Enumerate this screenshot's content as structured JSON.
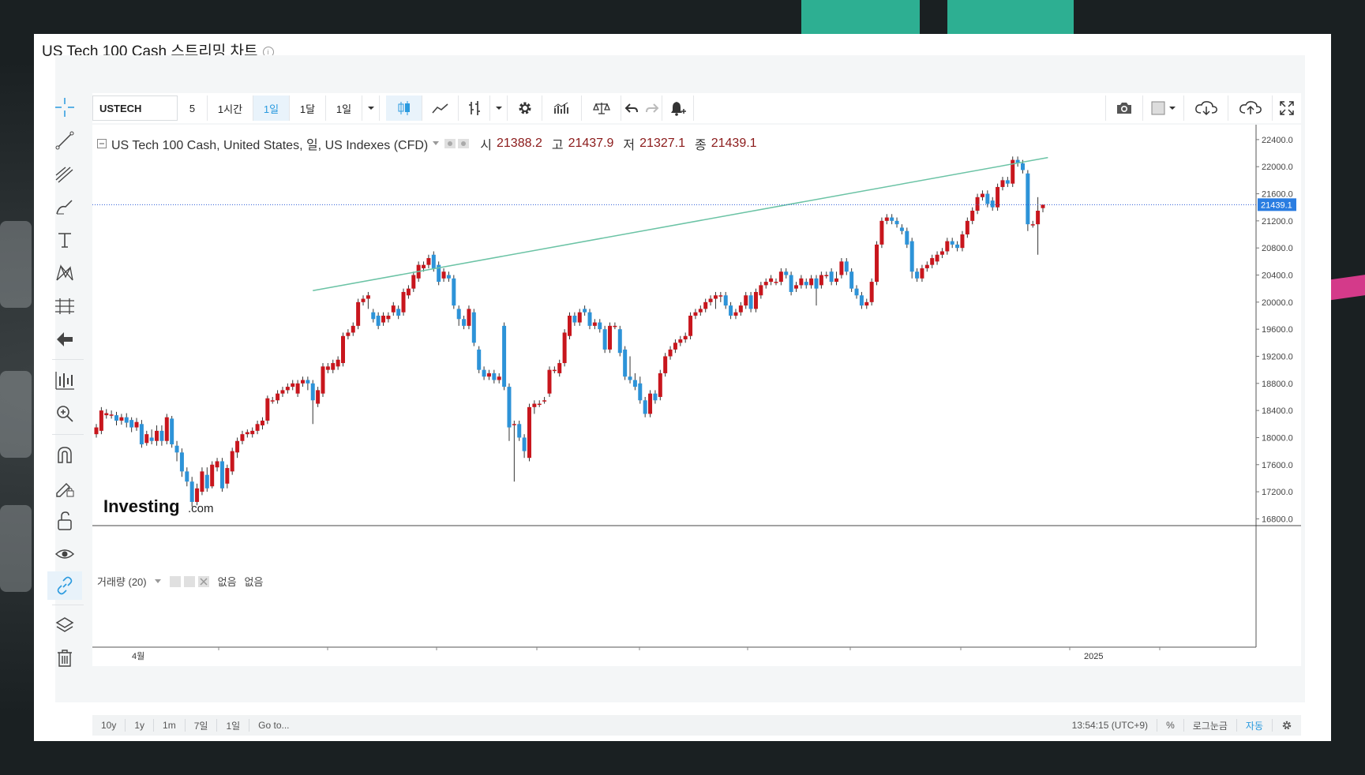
{
  "chart_title": "US Tech 100 Cash 스트리밍 차트",
  "toolbar": {
    "symbol": "USTECH",
    "intervals": [
      "5",
      "1시간",
      "1일",
      "1달",
      "1일"
    ],
    "active_interval_index": 2
  },
  "legend": {
    "name": "US Tech 100 Cash, United States, 일, US Indexes (CFD)",
    "open_label": "시",
    "open": "21388.2",
    "high_label": "고",
    "high": "21437.9",
    "low_label": "저",
    "low": "21327.1",
    "close_label": "종",
    "close": "21439.1"
  },
  "volume_legend": {
    "label": "거래량 (20)",
    "v1": "없음",
    "v2": "없음"
  },
  "last_price": "21439.1",
  "watermark": {
    "brand": "Investing",
    "suffix": ".com"
  },
  "bottom_bar": {
    "ranges": [
      "10y",
      "1y",
      "1m",
      "7일",
      "1일",
      "Go to..."
    ],
    "time": "13:54:15 (UTC+9)",
    "percent": "%",
    "log": "로그눈금",
    "auto": "자동"
  },
  "colors": {
    "up": "#c8161d",
    "down": "#2d93d8",
    "trendline": "#6bc3a5",
    "price_line": "#2a5bd7"
  },
  "chart_data": {
    "type": "candlestick",
    "x_tick_labels": [
      "4월",
      "2025"
    ],
    "y_ticks": [
      16800,
      17200,
      17600,
      18000,
      18400,
      18800,
      19200,
      19600,
      20000,
      20400,
      20800,
      21200,
      21600,
      22000,
      22400
    ],
    "ylim": [
      16700,
      22620
    ],
    "trendline": [
      [
        0,
        20170
      ],
      [
        102,
        22135
      ]
    ],
    "candles": [
      [
        18050,
        18150,
        18000,
        18200
      ],
      [
        18100,
        18400,
        18050,
        18450
      ],
      [
        18330,
        18360,
        18280,
        18420
      ],
      [
        18330,
        18340,
        18280,
        18400
      ],
      [
        18330,
        18250,
        18180,
        18380
      ],
      [
        18250,
        18300,
        18190,
        18350
      ],
      [
        18300,
        18220,
        18150,
        18360
      ],
      [
        18260,
        18150,
        18080,
        18300
      ],
      [
        18150,
        18230,
        18100,
        18290
      ],
      [
        18200,
        17900,
        17850,
        18260
      ],
      [
        17920,
        18050,
        17880,
        18100
      ],
      [
        18000,
        17950,
        17900,
        18120
      ],
      [
        17950,
        18100,
        17880,
        18180
      ],
      [
        18100,
        17950,
        17880,
        18180
      ],
      [
        17950,
        18300,
        17900,
        18350
      ],
      [
        18280,
        17900,
        17850,
        18320
      ],
      [
        17880,
        17780,
        17650,
        17950
      ],
      [
        17780,
        17500,
        17420,
        17840
      ],
      [
        17500,
        17350,
        17280,
        17560
      ],
      [
        17350,
        17050,
        16980,
        17420
      ],
      [
        17050,
        17250,
        17000,
        17320
      ],
      [
        17200,
        17500,
        17150,
        17560
      ],
      [
        17450,
        17250,
        17200,
        17560
      ],
      [
        17280,
        17600,
        17250,
        17650
      ],
      [
        17560,
        17650,
        17500,
        17700
      ],
      [
        17650,
        17250,
        17200,
        17700
      ],
      [
        17320,
        17550,
        17250,
        17600
      ],
      [
        17500,
        17800,
        17450,
        17850
      ],
      [
        17780,
        17950,
        17700,
        18000
      ],
      [
        17950,
        18050,
        17900,
        18100
      ],
      [
        18050,
        18080,
        18000,
        18120
      ],
      [
        18050,
        18100,
        18000,
        18150
      ],
      [
        18100,
        18200,
        18050,
        18250
      ],
      [
        18180,
        18250,
        18120,
        18300
      ],
      [
        18250,
        18580,
        18200,
        18620
      ],
      [
        18550,
        18550,
        18500,
        18600
      ],
      [
        18550,
        18650,
        18500,
        18700
      ],
      [
        18650,
        18700,
        18600,
        18750
      ],
      [
        18700,
        18750,
        18650,
        18800
      ],
      [
        18750,
        18800,
        18700,
        18850
      ],
      [
        18650,
        18800,
        18600,
        18850
      ],
      [
        18800,
        18850,
        18750,
        18900
      ],
      [
        18850,
        18800,
        18700,
        18900
      ],
      [
        18800,
        18550,
        18200,
        18850
      ],
      [
        18500,
        18700,
        18450,
        18750
      ],
      [
        18650,
        19050,
        18600,
        19100
      ],
      [
        19000,
        19050,
        18950,
        19100
      ],
      [
        19000,
        19100,
        18950,
        19150
      ],
      [
        19050,
        19150,
        19000,
        19200
      ],
      [
        19100,
        19500,
        19050,
        19550
      ],
      [
        19500,
        19550,
        19450,
        19600
      ],
      [
        19550,
        19650,
        19500,
        19700
      ],
      [
        19650,
        20000,
        19600,
        20050
      ],
      [
        20000,
        20050,
        19950,
        20100
      ],
      [
        20050,
        20100,
        19900,
        20150
      ],
      [
        19850,
        19750,
        19700,
        19900
      ],
      [
        19800,
        19650,
        19600,
        19850
      ],
      [
        19700,
        19800,
        19650,
        19850
      ],
      [
        19750,
        19800,
        19700,
        19850
      ],
      [
        19850,
        19950,
        19800,
        20000
      ],
      [
        19900,
        19800,
        19750,
        19950
      ],
      [
        19850,
        20150,
        19800,
        20200
      ],
      [
        20100,
        20200,
        20050,
        20250
      ],
      [
        20200,
        20400,
        20150,
        20450
      ],
      [
        20350,
        20550,
        20300,
        20600
      ],
      [
        20500,
        20550,
        20450,
        20600
      ],
      [
        20550,
        20650,
        20500,
        20700
      ],
      [
        20700,
        20500,
        20450,
        20750
      ],
      [
        20550,
        20300,
        20250,
        20600
      ],
      [
        20350,
        20450,
        20300,
        20500
      ],
      [
        20400,
        20350,
        20300,
        20450
      ],
      [
        20350,
        19950,
        19900,
        20400
      ],
      [
        19900,
        19750,
        19650,
        19950
      ],
      [
        19750,
        19650,
        19600,
        19800
      ],
      [
        19650,
        19900,
        19600,
        19950
      ],
      [
        19850,
        19400,
        19350,
        19900
      ],
      [
        19300,
        19000,
        18950,
        19350
      ],
      [
        19000,
        18900,
        18850,
        19050
      ],
      [
        18900,
        18950,
        18850,
        19000
      ],
      [
        18950,
        18850,
        18800,
        19000
      ],
      [
        18850,
        18900,
        18800,
        18950
      ],
      [
        19650,
        18750,
        18700,
        19700
      ],
      [
        18750,
        18150,
        17950,
        18800
      ],
      [
        18200,
        18200,
        17350,
        18250
      ],
      [
        18200,
        18000,
        17950,
        18250
      ],
      [
        18000,
        17800,
        17700,
        18050
      ],
      [
        17700,
        18450,
        17650,
        18500
      ],
      [
        18450,
        18500,
        18350,
        18550
      ],
      [
        18500,
        18500,
        18450,
        18550
      ],
      [
        18550,
        18550,
        18500,
        18600
      ],
      [
        18650,
        19000,
        18600,
        19050
      ],
      [
        19000,
        19000,
        18950,
        19050
      ],
      [
        18950,
        19100,
        18900,
        19150
      ],
      [
        19100,
        19550,
        19050,
        19600
      ],
      [
        19500,
        19800,
        19450,
        19850
      ],
      [
        19800,
        19700,
        19650,
        19850
      ],
      [
        19700,
        19850,
        19650,
        19900
      ],
      [
        19900,
        19850,
        19800,
        19950
      ],
      [
        19850,
        19650,
        19600,
        19900
      ],
      [
        19650,
        19700,
        19600,
        19750
      ],
      [
        19700,
        19600,
        19550,
        19750
      ],
      [
        19600,
        19300,
        19250,
        19650
      ],
      [
        19300,
        19650,
        19250,
        19700
      ],
      [
        19650,
        19650,
        19600,
        19700
      ],
      [
        19600,
        19250,
        19200,
        19650
      ],
      [
        19300,
        18900,
        18850,
        19350
      ],
      [
        18900,
        18850,
        18800,
        19200
      ],
      [
        18850,
        18750,
        18700,
        18950
      ],
      [
        18800,
        18550,
        18500,
        18900
      ],
      [
        18550,
        18350,
        18300,
        18600
      ],
      [
        18350,
        18650,
        18300,
        18700
      ],
      [
        18650,
        18550,
        18500,
        18700
      ],
      [
        18600,
        18950,
        18550,
        19000
      ],
      [
        18950,
        19200,
        18900,
        19250
      ],
      [
        19200,
        19300,
        19150,
        19350
      ],
      [
        19300,
        19400,
        19250,
        19450
      ],
      [
        19400,
        19450,
        19350,
        19500
      ],
      [
        19450,
        19500,
        19400,
        19550
      ],
      [
        19500,
        19800,
        19450,
        19850
      ],
      [
        19800,
        19850,
        19750,
        19900
      ],
      [
        19850,
        19900,
        19800,
        19950
      ],
      [
        19900,
        20000,
        19850,
        20050
      ],
      [
        20000,
        20050,
        19950,
        20100
      ],
      [
        20050,
        20100,
        19900,
        20150
      ],
      [
        20100,
        20100,
        20000,
        20150
      ],
      [
        20100,
        19950,
        19900,
        20150
      ],
      [
        19950,
        19800,
        19750,
        20000
      ],
      [
        19800,
        19850,
        19750,
        19900
      ],
      [
        19850,
        19950,
        19800,
        20000
      ],
      [
        19950,
        20100,
        19900,
        20150
      ],
      [
        20100,
        19900,
        19850,
        20150
      ],
      [
        19900,
        20150,
        19850,
        20200
      ],
      [
        20100,
        20250,
        20050,
        20300
      ],
      [
        20250,
        20300,
        20200,
        20350
      ],
      [
        20300,
        20350,
        20250,
        20400
      ],
      [
        20300,
        20300,
        20250,
        20350
      ],
      [
        20300,
        20450,
        20250,
        20500
      ],
      [
        20450,
        20400,
        20350,
        20500
      ],
      [
        20400,
        20150,
        20100,
        20450
      ],
      [
        20200,
        20250,
        20150,
        20300
      ],
      [
        20250,
        20350,
        20200,
        20400
      ],
      [
        20300,
        20250,
        20200,
        20350
      ],
      [
        20250,
        20350,
        20200,
        20400
      ],
      [
        20350,
        20200,
        19950,
        20400
      ],
      [
        20250,
        20400,
        20200,
        20450
      ],
      [
        20400,
        20400,
        20350,
        20450
      ],
      [
        20450,
        20300,
        20250,
        20500
      ],
      [
        20300,
        20350,
        20250,
        20450
      ],
      [
        20400,
        20600,
        20350,
        20650
      ],
      [
        20600,
        20450,
        20400,
        20650
      ],
      [
        20450,
        20200,
        20150,
        20500
      ],
      [
        20200,
        20100,
        20050,
        20250
      ],
      [
        20100,
        19950,
        19900,
        20150
      ],
      [
        19950,
        20000,
        19900,
        20050
      ],
      [
        20000,
        20300,
        19950,
        20350
      ],
      [
        20300,
        20850,
        20250,
        20900
      ],
      [
        20850,
        21200,
        20800,
        21250
      ],
      [
        21200,
        21250,
        21150,
        21300
      ],
      [
        21250,
        21200,
        21150,
        21300
      ],
      [
        21200,
        21150,
        21100,
        21250
      ],
      [
        21100,
        21050,
        21000,
        21150
      ],
      [
        21050,
        20850,
        20800,
        21100
      ],
      [
        20900,
        20450,
        20350,
        20950
      ],
      [
        20450,
        20350,
        20300,
        20500
      ],
      [
        20350,
        20500,
        20300,
        20550
      ],
      [
        20500,
        20550,
        20450,
        20600
      ],
      [
        20550,
        20650,
        20500,
        20700
      ],
      [
        20600,
        20700,
        20550,
        20750
      ],
      [
        20700,
        20750,
        20650,
        20800
      ],
      [
        20750,
        20900,
        20700,
        20950
      ],
      [
        20900,
        20850,
        20800,
        20950
      ],
      [
        20850,
        20800,
        20750,
        20900
      ],
      [
        20800,
        21000,
        20750,
        21050
      ],
      [
        21000,
        21200,
        20950,
        21250
      ],
      [
        21200,
        21350,
        21150,
        21400
      ],
      [
        21350,
        21550,
        21300,
        21600
      ],
      [
        21550,
        21600,
        21500,
        21650
      ],
      [
        21600,
        21450,
        21400,
        21650
      ],
      [
        21500,
        21400,
        21350,
        21550
      ],
      [
        21400,
        21700,
        21350,
        21750
      ],
      [
        21700,
        21800,
        21650,
        21850
      ],
      [
        21800,
        21750,
        21700,
        21850
      ],
      [
        21750,
        22100,
        21700,
        22150
      ],
      [
        22100,
        22050,
        22000,
        22150
      ],
      [
        22050,
        21950,
        21900,
        22100
      ],
      [
        21900,
        21150,
        21050,
        21950
      ],
      [
        21150,
        21150,
        21100,
        21200
      ],
      [
        21150,
        21350,
        20700,
        21550
      ],
      [
        21388.2,
        21439.1,
        21327.1,
        21437.9
      ]
    ]
  }
}
